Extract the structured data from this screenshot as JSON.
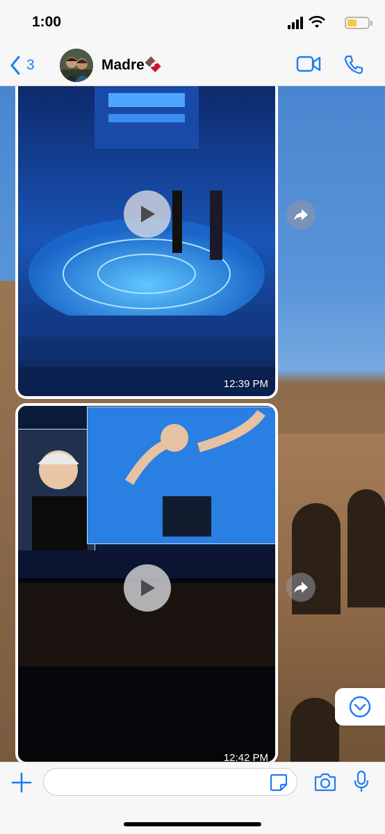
{
  "status_bar": {
    "time": "1:00",
    "icons": [
      "signal-icon",
      "wifi-icon",
      "battery-icon"
    ],
    "battery_color": "#f6c845"
  },
  "header": {
    "back_count": "3",
    "contact_name": "Madre🍫",
    "icons": [
      "chevron-left-icon",
      "video-camera-icon",
      "phone-icon"
    ],
    "accent_color": "#1f7cf2"
  },
  "messages": [
    {
      "type": "video",
      "timestamp": "12:39 PM"
    },
    {
      "type": "video",
      "timestamp": "12:42 PM"
    }
  ],
  "input": {
    "placeholder": "",
    "value": "",
    "icons": [
      "plus-icon",
      "sticker-icon",
      "camera-icon",
      "microphone-icon"
    ]
  }
}
